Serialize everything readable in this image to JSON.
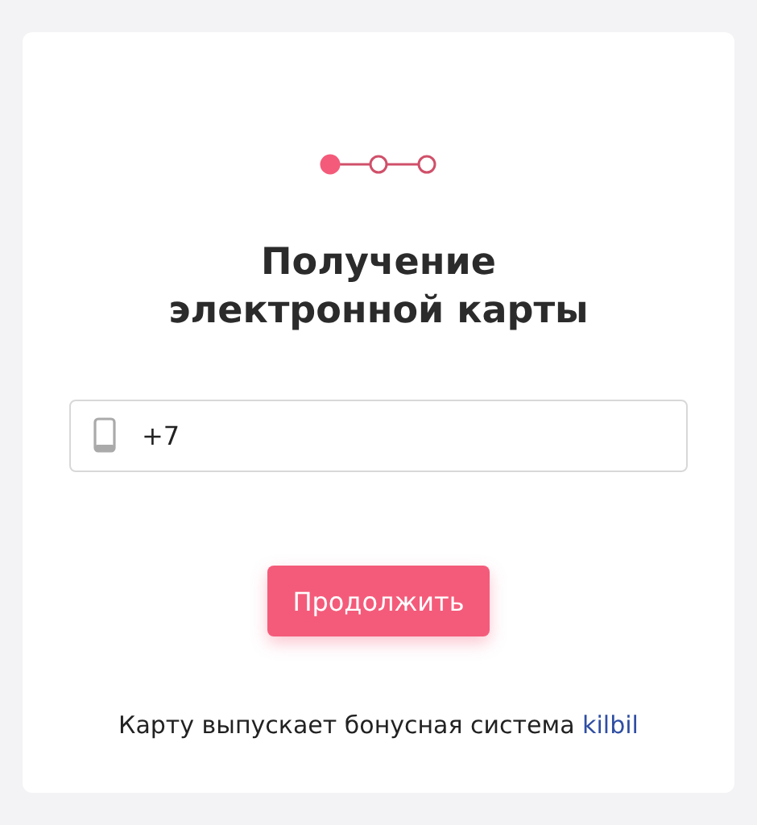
{
  "steps": [
    {
      "selected": true
    },
    {
      "selected": false
    },
    {
      "selected": false
    }
  ],
  "title": "Получение электронной карты",
  "phone_field": {
    "value": "+7"
  },
  "continue_button": "Продолжить",
  "footer": {
    "text": "Карту выпускает бонусная система",
    "link": "kilbil"
  }
}
